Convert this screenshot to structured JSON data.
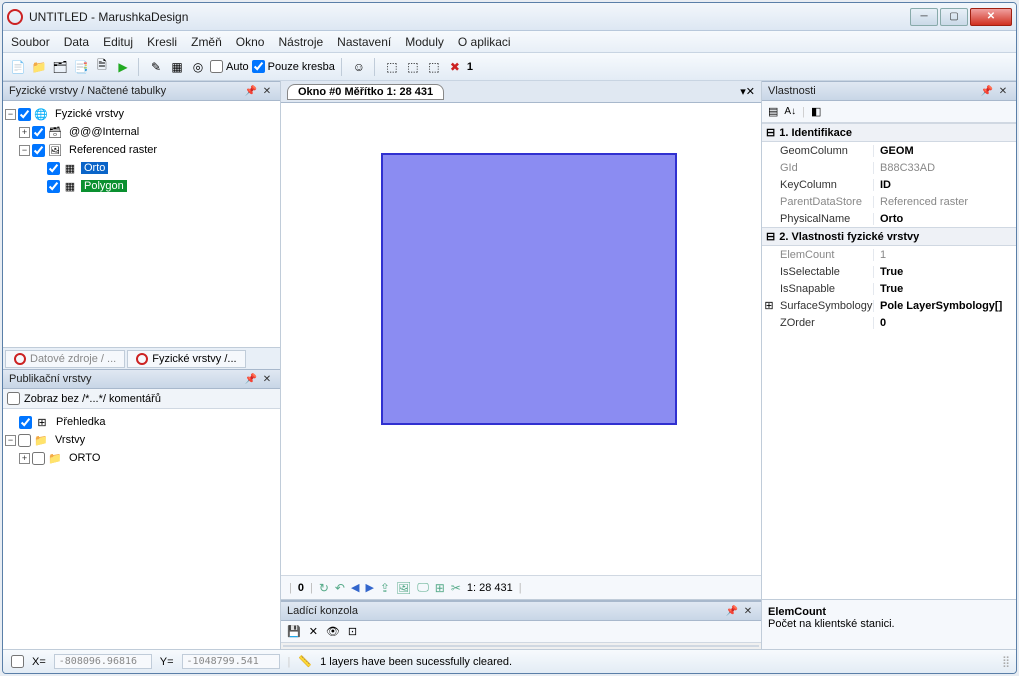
{
  "title": "UNTITLED - MarushkaDesign",
  "menu": [
    "Soubor",
    "Data",
    "Edituj",
    "Kresli",
    "Změň",
    "Okno",
    "Nástroje",
    "Nastavení",
    "Moduly",
    "O aplikaci"
  ],
  "toolbar": {
    "auto": "Auto",
    "pouze_kresba": "Pouze kresba",
    "one": "1"
  },
  "physical_panel": {
    "title": "Fyzické vrstvy / Načtené tabulky",
    "root": "Fyzické vrstvy",
    "items": [
      "@@@Internal",
      "Referenced raster"
    ],
    "children": [
      "Orto",
      "Polygon"
    ]
  },
  "left_tabs": [
    "Datové zdroje / ...",
    "Fyzické vrstvy /..."
  ],
  "pub_panel": {
    "title": "Publikační vrstvy",
    "show_label": "Zobraz bez /*...*/ komentářů",
    "items": [
      "Přehledka",
      "Vrstvy",
      "ORTO"
    ]
  },
  "doc_tab": "Okno #0 Měřítko 1:  28 431",
  "canvas_footer": {
    "zero": "0",
    "scale": "1:  28 431"
  },
  "debug_title": "Ladící konzola",
  "props_panel": {
    "title": "Vlastnosti",
    "cats": [
      "1. Identifikace",
      "2. Vlastnosti fyzické vrstvy"
    ],
    "rows1": [
      {
        "n": "GeomColumn",
        "v": "GEOM"
      },
      {
        "n": "GId",
        "v": "B88C33AD",
        "ro": true
      },
      {
        "n": "KeyColumn",
        "v": "ID"
      },
      {
        "n": "ParentDataStore",
        "v": "Referenced raster",
        "ro": true
      },
      {
        "n": "PhysicalName",
        "v": "Orto"
      }
    ],
    "rows2": [
      {
        "n": "ElemCount",
        "v": "1",
        "ro": true
      },
      {
        "n": "IsSelectable",
        "v": "True"
      },
      {
        "n": "IsSnapable",
        "v": "True"
      },
      {
        "n": "SurfaceSymbology",
        "v": "Pole LayerSymbology[]",
        "exp": true
      },
      {
        "n": "ZOrder",
        "v": "0"
      }
    ],
    "desc_title": "ElemCount",
    "desc_text": "Počet na klientské stanici."
  },
  "status": {
    "x_label": "X=",
    "x_val": "-808096.96816",
    "y_label": "Y=",
    "y_val": "-1048799.541",
    "msg": "1 layers have been sucessfully cleared."
  }
}
